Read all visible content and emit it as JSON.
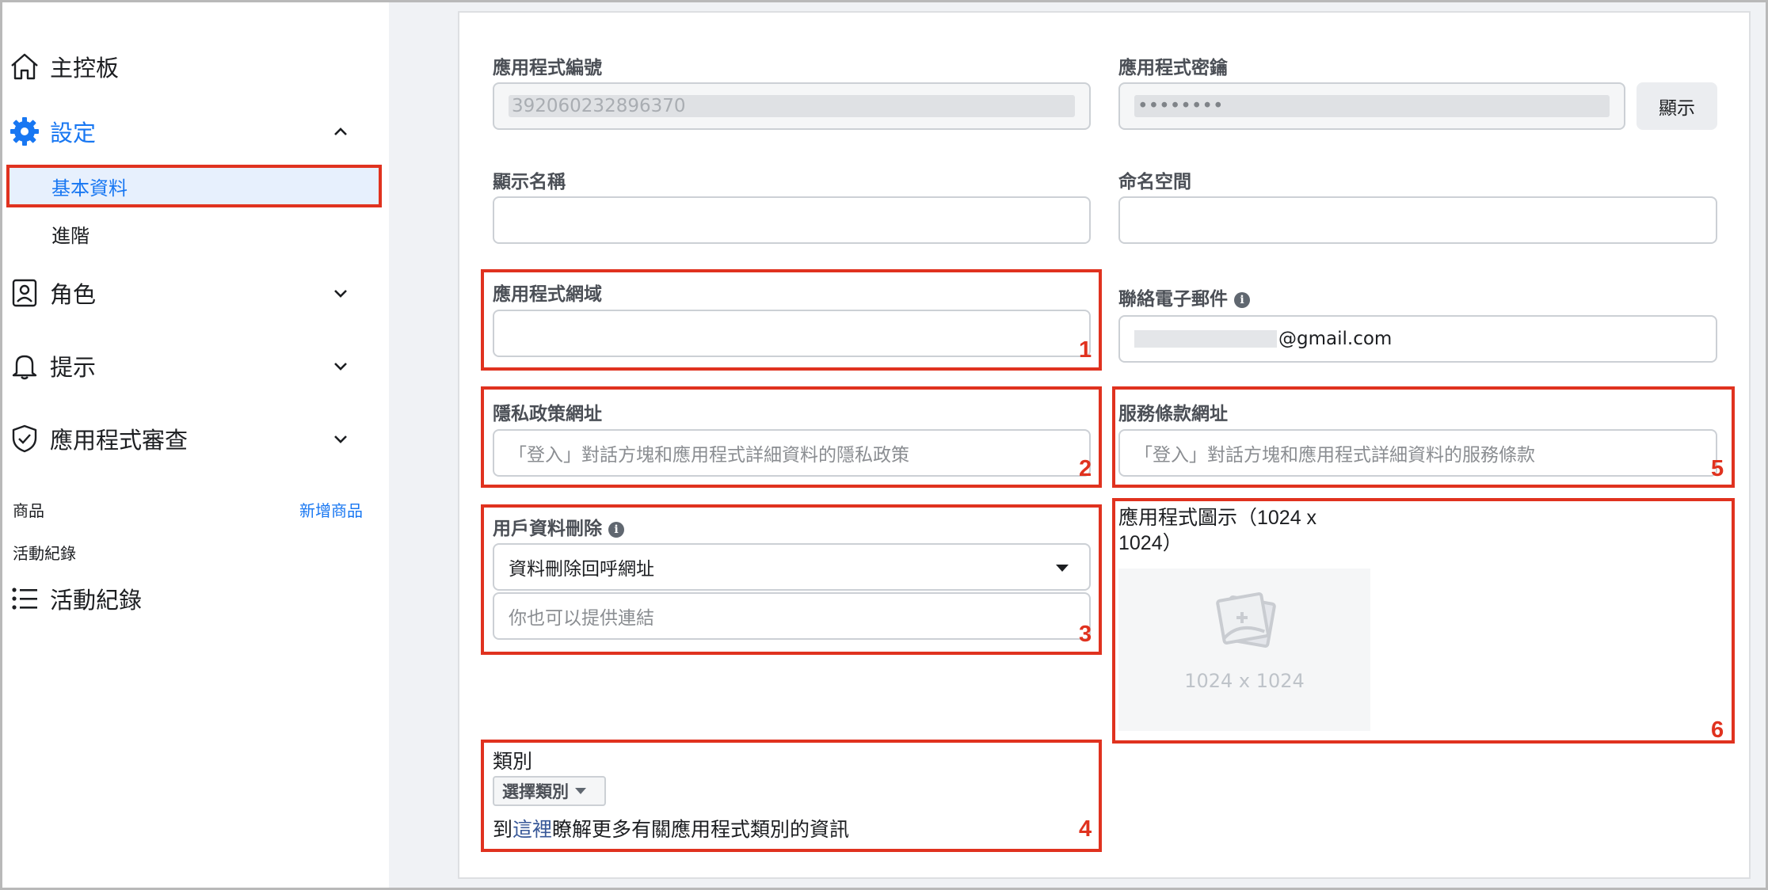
{
  "sidebar": {
    "dashboard": {
      "label": "主控板",
      "icon": "home-icon"
    },
    "settings": {
      "label": "設定",
      "icon": "gear-icon",
      "expanded": true
    },
    "settings_sub": [
      {
        "label": "基本資料",
        "selected": true
      },
      {
        "label": "進階",
        "selected": false
      }
    ],
    "roles": {
      "label": "角色",
      "icon": "id-badge-icon"
    },
    "alerts": {
      "label": "提示",
      "icon": "bell-icon"
    },
    "app_review": {
      "label": "應用程式審查",
      "icon": "shield-check-icon"
    },
    "products_label": "商品",
    "add_product_link": "新增商品",
    "activity_section_label": "活動紀錄",
    "activity_log": {
      "label": "活動紀錄",
      "icon": "list-icon"
    }
  },
  "form": {
    "app_id": {
      "label": "應用程式編號",
      "value": "392060232896370"
    },
    "app_secret": {
      "label": "應用程式密鑰",
      "value": "••••••••",
      "show_button": "顯示"
    },
    "display_name": {
      "label": "顯示名稱",
      "value": ""
    },
    "namespace": {
      "label": "命名空間",
      "value": ""
    },
    "app_domains": {
      "label": "應用程式網域",
      "value": ""
    },
    "contact_email": {
      "label": "聯絡電子郵件",
      "value": "@gmail.com"
    },
    "privacy_url": {
      "label": "隱私政策網址",
      "placeholder": "「登入」對話方塊和應用程式詳細資料的隱私政策"
    },
    "terms_url": {
      "label": "服務條款網址",
      "placeholder": "「登入」對話方塊和應用程式詳細資料的服務條款"
    },
    "data_deletion": {
      "label": "用戶資料刪除",
      "selected_option": "資料刪除回呼網址",
      "placeholder": "你也可以提供連結"
    },
    "app_icon": {
      "label_line1": "應用程式圖示（1024 x",
      "label_line2": "1024）",
      "size_text": "1024 x 1024"
    },
    "category": {
      "label": "類別",
      "button": "選擇類別",
      "hint_prefix": "到",
      "hint_link": "這裡",
      "hint_suffix": "瞭解更多有關應用程式類別的資訊"
    }
  },
  "annotations": [
    "1",
    "2",
    "3",
    "4",
    "5",
    "6"
  ],
  "colors": {
    "accent": "#1877f2",
    "annotation_red": "#e0321f",
    "page_bg": "#f0f2f5"
  }
}
